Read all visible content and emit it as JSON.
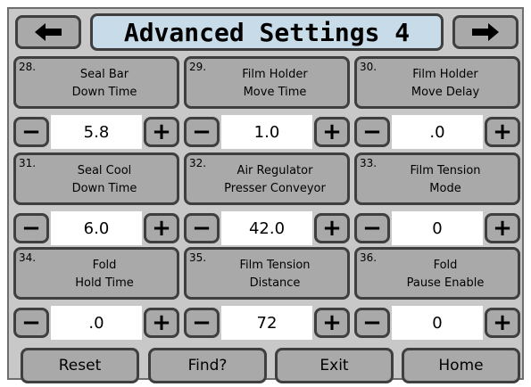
{
  "header": {
    "title": "Advanced Settings 4",
    "prev_icon": "arrow-left-icon",
    "next_icon": "arrow-right-icon"
  },
  "params": [
    {
      "number": "28.",
      "name": "Seal Bar\nDown Time",
      "value": "5.8"
    },
    {
      "number": "29.",
      "name": "Film Holder\nMove Time",
      "value": "1.0"
    },
    {
      "number": "30.",
      "name": "Film Holder\nMove Delay",
      "value": ".0"
    },
    {
      "number": "31.",
      "name": "Seal Cool\nDown Time",
      "value": "6.0"
    },
    {
      "number": "32.",
      "name": "Air Regulator\nPresser Conveyor",
      "value": "42.0"
    },
    {
      "number": "33.",
      "name": "Film Tension\nMode",
      "value": "0"
    },
    {
      "number": "34.",
      "name": "Fold\nHold Time",
      "value": ".0"
    },
    {
      "number": "35.",
      "name": "Film Tension\nDistance",
      "value": "72"
    },
    {
      "number": "36.",
      "name": "Fold\nPause Enable",
      "value": "0"
    }
  ],
  "stepper": {
    "minus_label": "−",
    "plus_label": "+"
  },
  "footer": {
    "reset_label": "Reset",
    "find_label": "Find?",
    "exit_label": "Exit",
    "home_label": "Home"
  },
  "colors": {
    "panel_bg": "#c8c8c8",
    "button_bg": "#a9a9a9",
    "title_bg": "#c7dbe9",
    "border": "#3f3f3f",
    "value_bg": "#ffffff"
  }
}
